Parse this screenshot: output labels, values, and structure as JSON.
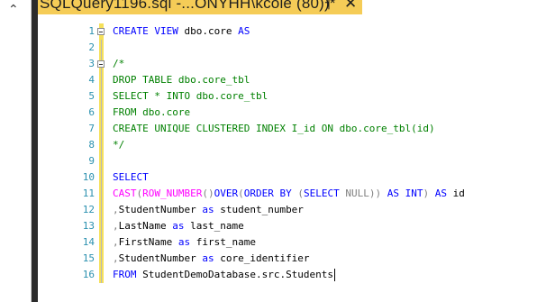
{
  "tab": {
    "title": "SQLQuery1196.sql -...ONYHH\\kcole (80))*",
    "pin_glyph": "┤",
    "close_glyph": "✕"
  },
  "colors": {
    "keyword": "#0000ff",
    "function": "#ff00ff",
    "operator": "#808080",
    "comment": "#008000",
    "line_number": "#2b91af",
    "tab_active": "#f5cc57",
    "change_marker": "#f5e05a"
  },
  "lines": [
    {
      "num": "1",
      "tokens": [
        {
          "t": "CREATE VIEW",
          "c": "kw"
        },
        {
          "t": " dbo.core ",
          "c": "tx"
        },
        {
          "t": "AS",
          "c": "kw"
        }
      ]
    },
    {
      "num": "2",
      "tokens": []
    },
    {
      "num": "3",
      "tokens": [
        {
          "t": "/*",
          "c": "cm"
        }
      ]
    },
    {
      "num": "4",
      "tokens": [
        {
          "t": "DROP TABLE dbo.core_tbl",
          "c": "cm"
        }
      ]
    },
    {
      "num": "5",
      "tokens": [
        {
          "t": "SELECT * INTO dbo.core_tbl",
          "c": "cm"
        }
      ]
    },
    {
      "num": "6",
      "tokens": [
        {
          "t": "FROM dbo.core",
          "c": "cm"
        }
      ]
    },
    {
      "num": "7",
      "tokens": [
        {
          "t": "CREATE UNIQUE CLUSTERED INDEX I_id ON dbo.core_tbl(id)",
          "c": "cm"
        }
      ]
    },
    {
      "num": "8",
      "tokens": [
        {
          "t": "*/",
          "c": "cm"
        }
      ]
    },
    {
      "num": "9",
      "tokens": []
    },
    {
      "num": "10",
      "tokens": [
        {
          "t": "SELECT",
          "c": "kw"
        }
      ]
    },
    {
      "num": "11",
      "tokens": [
        {
          "t": "CAST",
          "c": "fn"
        },
        {
          "t": "(",
          "c": "op"
        },
        {
          "t": "ROW_NUMBER",
          "c": "fn"
        },
        {
          "t": "()",
          "c": "op"
        },
        {
          "t": "OVER",
          "c": "kw"
        },
        {
          "t": "(",
          "c": "op"
        },
        {
          "t": "ORDER BY",
          "c": "kw"
        },
        {
          "t": " (",
          "c": "op"
        },
        {
          "t": "SELECT",
          "c": "kw"
        },
        {
          "t": " ",
          "c": "tx"
        },
        {
          "t": "NULL",
          "c": "op"
        },
        {
          "t": ")) ",
          "c": "op"
        },
        {
          "t": "AS INT",
          "c": "kw"
        },
        {
          "t": ") ",
          "c": "op"
        },
        {
          "t": "AS",
          "c": "kw"
        },
        {
          "t": " id",
          "c": "tx"
        }
      ]
    },
    {
      "num": "12",
      "tokens": [
        {
          "t": ",",
          "c": "op"
        },
        {
          "t": "StudentNumber ",
          "c": "tx"
        },
        {
          "t": "as",
          "c": "kw"
        },
        {
          "t": " student_number",
          "c": "tx"
        }
      ]
    },
    {
      "num": "13",
      "tokens": [
        {
          "t": ",",
          "c": "op"
        },
        {
          "t": "LastName ",
          "c": "tx"
        },
        {
          "t": "as",
          "c": "kw"
        },
        {
          "t": " last_name",
          "c": "tx"
        }
      ]
    },
    {
      "num": "14",
      "tokens": [
        {
          "t": ",",
          "c": "op"
        },
        {
          "t": "FirstName ",
          "c": "tx"
        },
        {
          "t": "as",
          "c": "kw"
        },
        {
          "t": " first_name",
          "c": "tx"
        }
      ]
    },
    {
      "num": "15",
      "tokens": [
        {
          "t": ",",
          "c": "op"
        },
        {
          "t": "StudentNumber ",
          "c": "tx"
        },
        {
          "t": "as",
          "c": "kw"
        },
        {
          "t": " core_identifier",
          "c": "tx"
        }
      ]
    },
    {
      "num": "16",
      "tokens": [
        {
          "t": "FROM",
          "c": "kw"
        },
        {
          "t": " StudentDemoDatabase.src.Students",
          "c": "tx"
        }
      ]
    }
  ]
}
